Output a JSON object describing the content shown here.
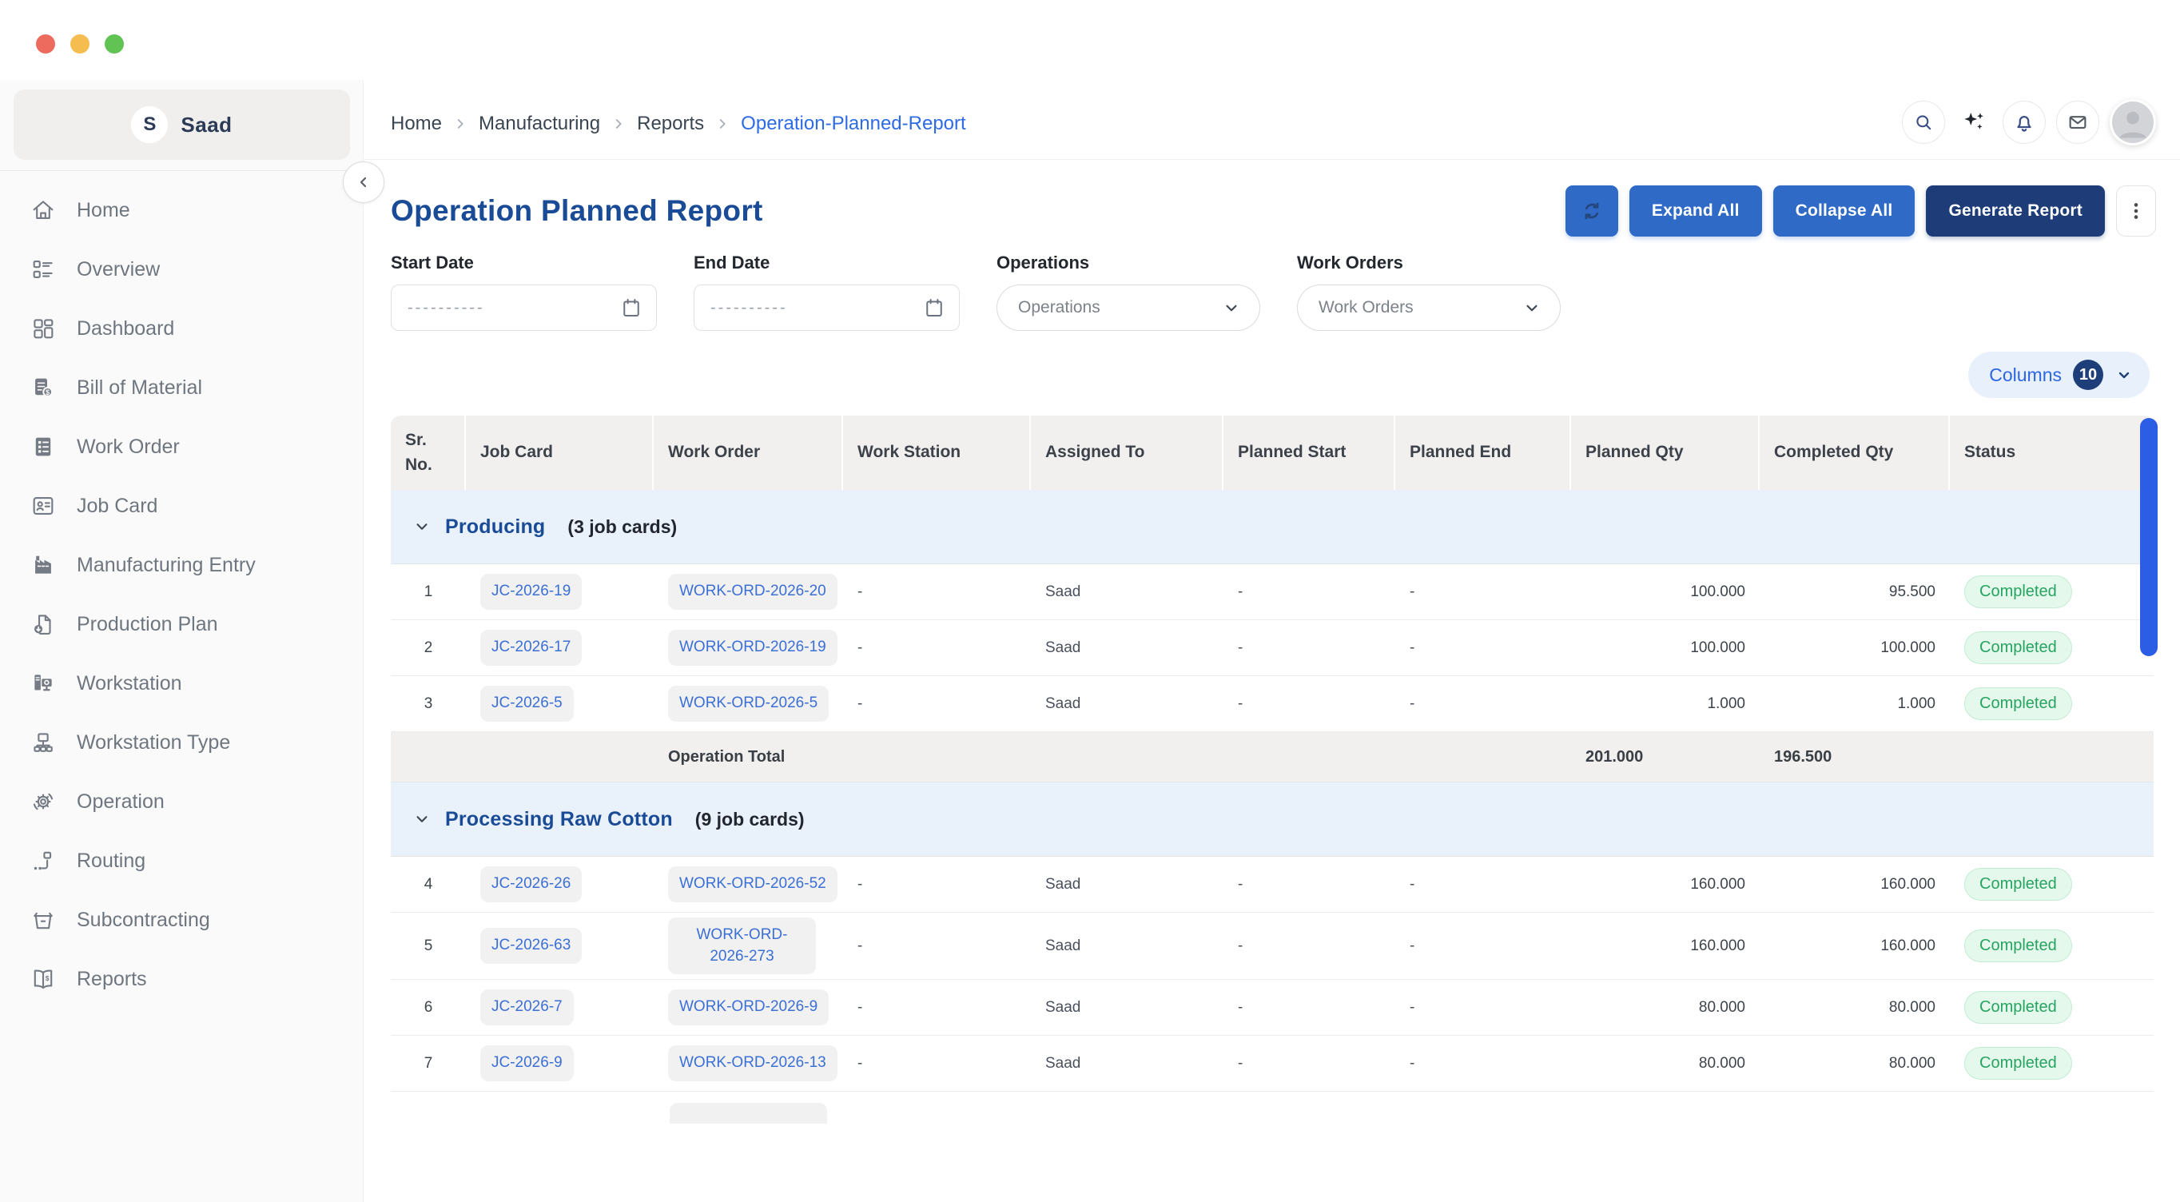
{
  "sidebar": {
    "user": {
      "initial": "S",
      "name": "Saad"
    },
    "items": [
      {
        "label": "Home",
        "icon": "home-icon"
      },
      {
        "label": "Overview",
        "icon": "overview-icon"
      },
      {
        "label": "Dashboard",
        "icon": "dashboard-icon"
      },
      {
        "label": "Bill of Material",
        "icon": "bill-of-material-icon"
      },
      {
        "label": "Work Order",
        "icon": "work-order-icon"
      },
      {
        "label": "Job Card",
        "icon": "job-card-icon"
      },
      {
        "label": "Manufacturing Entry",
        "icon": "manufacturing-entry-icon"
      },
      {
        "label": "Production Plan",
        "icon": "production-plan-icon"
      },
      {
        "label": "Workstation",
        "icon": "workstation-icon"
      },
      {
        "label": "Workstation Type",
        "icon": "workstation-type-icon"
      },
      {
        "label": "Operation",
        "icon": "operation-icon"
      },
      {
        "label": "Routing",
        "icon": "routing-icon"
      },
      {
        "label": "Subcontracting",
        "icon": "subcontracting-icon"
      },
      {
        "label": "Reports",
        "icon": "reports-icon"
      }
    ]
  },
  "breadcrumb": [
    {
      "label": "Home",
      "active": false
    },
    {
      "label": "Manufacturing",
      "active": false
    },
    {
      "label": "Reports",
      "active": false
    },
    {
      "label": "Operation-Planned-Report",
      "active": true
    }
  ],
  "topbar_icons": [
    "search-icon",
    "sparkles-icon",
    "bell-icon",
    "mail-icon",
    "avatar"
  ],
  "page": {
    "title": "Operation Planned Report",
    "buttons": {
      "expand_all": "Expand All",
      "collapse_all": "Collapse All",
      "generate_report": "Generate Report"
    }
  },
  "filters": {
    "start_date": {
      "label": "Start Date",
      "placeholder": "----------"
    },
    "end_date": {
      "label": "End Date",
      "placeholder": "----------"
    },
    "operations": {
      "label": "Operations",
      "value": "Operations"
    },
    "work_orders": {
      "label": "Work Orders",
      "value": "Work Orders"
    }
  },
  "columns_control": {
    "label": "Columns",
    "count": "10"
  },
  "table": {
    "headers": [
      "Sr. No.",
      "Job Card",
      "Work Order",
      "Work Station",
      "Assigned To",
      "Planned Start",
      "Planned End",
      "Planned Qty",
      "Completed Qty",
      "Status"
    ],
    "groups": [
      {
        "name": "Producing",
        "count_label": "(3 job cards)",
        "rows": [
          {
            "sr": "1",
            "job_card": "JC-2026-19",
            "work_order": "WORK-ORD-2026-20",
            "work_station": "-",
            "assigned_to": "Saad",
            "planned_start": "-",
            "planned_end": "-",
            "planned_qty": "100.000",
            "completed_qty": "95.500",
            "status": "Completed"
          },
          {
            "sr": "2",
            "job_card": "JC-2026-17",
            "work_order": "WORK-ORD-2026-19",
            "work_station": "-",
            "assigned_to": "Saad",
            "planned_start": "-",
            "planned_end": "-",
            "planned_qty": "100.000",
            "completed_qty": "100.000",
            "status": "Completed"
          },
          {
            "sr": "3",
            "job_card": "JC-2026-5",
            "work_order": "WORK-ORD-2026-5",
            "work_station": "-",
            "assigned_to": "Saad",
            "planned_start": "-",
            "planned_end": "-",
            "planned_qty": "1.000",
            "completed_qty": "1.000",
            "status": "Completed"
          }
        ],
        "total": {
          "label": "Operation Total",
          "planned_qty": "201.000",
          "completed_qty": "196.500"
        }
      },
      {
        "name": "Processing Raw Cotton",
        "count_label": "(9 job cards)",
        "rows": [
          {
            "sr": "4",
            "job_card": "JC-2026-26",
            "work_order": "WORK-ORD-2026-52",
            "work_station": "-",
            "assigned_to": "Saad",
            "planned_start": "-",
            "planned_end": "-",
            "planned_qty": "160.000",
            "completed_qty": "160.000",
            "status": "Completed"
          },
          {
            "sr": "5",
            "job_card": "JC-2026-63",
            "work_order": "WORK-ORD-2026-273",
            "work_station": "-",
            "assigned_to": "Saad",
            "planned_start": "-",
            "planned_end": "-",
            "planned_qty": "160.000",
            "completed_qty": "160.000",
            "status": "Completed"
          },
          {
            "sr": "6",
            "job_card": "JC-2026-7",
            "work_order": "WORK-ORD-2026-9",
            "work_station": "-",
            "assigned_to": "Saad",
            "planned_start": "-",
            "planned_end": "-",
            "planned_qty": "80.000",
            "completed_qty": "80.000",
            "status": "Completed"
          },
          {
            "sr": "7",
            "job_card": "JC-2026-9",
            "work_order": "WORK-ORD-2026-13",
            "work_station": "-",
            "assigned_to": "Saad",
            "planned_start": "-",
            "planned_end": "-",
            "planned_qty": "80.000",
            "completed_qty": "80.000",
            "status": "Completed"
          }
        ]
      }
    ]
  },
  "colors": {
    "accent_blue": "#2e6ac6",
    "navy": "#1e3d78",
    "title_blue": "#1a4b96",
    "link_blue": "#3b6fd6",
    "breadcrumb_active": "#2e6be5",
    "status_green": "#27a361",
    "status_green_bg": "#e5f8ec",
    "group_header_bg": "#e9f1fb",
    "table_header_bg": "#f1f0ef",
    "scrollbar_blue": "#2c5de5"
  }
}
